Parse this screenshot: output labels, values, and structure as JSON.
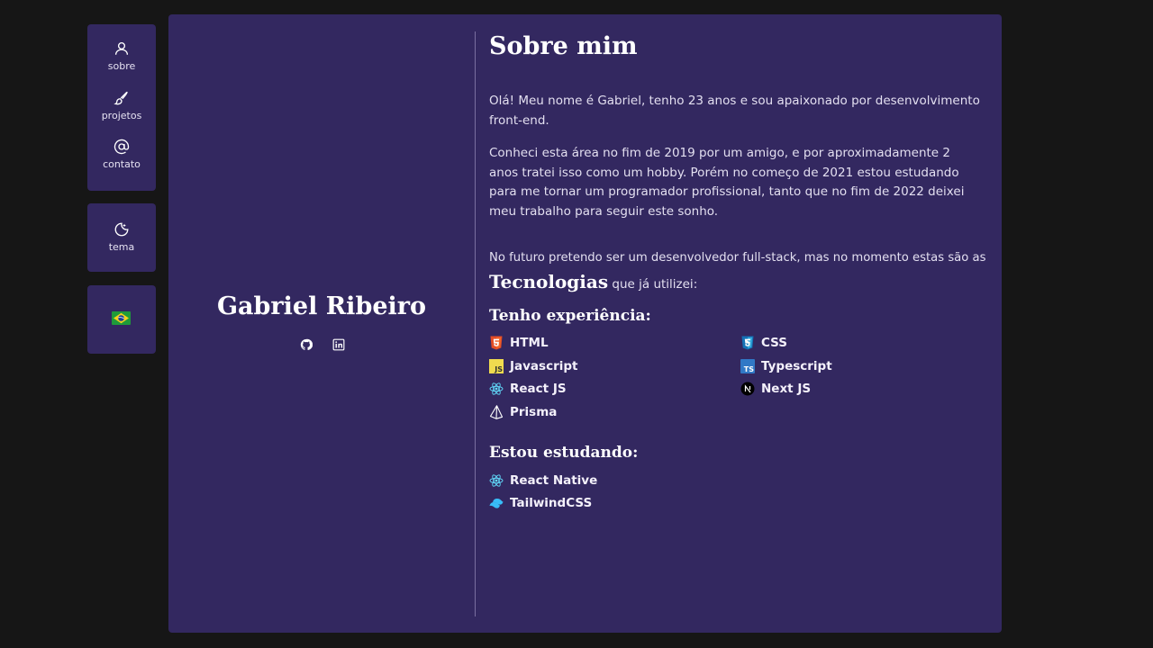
{
  "sidebar": {
    "nav": [
      {
        "label": "sobre",
        "icon": "user-icon"
      },
      {
        "label": "projetos",
        "icon": "brush-icon"
      },
      {
        "label": "contato",
        "icon": "at-sign-icon"
      }
    ],
    "theme": {
      "label": "tema",
      "icon": "moon-icon"
    },
    "language": {
      "icon": "brazil-flag-icon"
    }
  },
  "profile": {
    "name": "Gabriel Ribeiro",
    "socials": [
      {
        "icon": "github-icon"
      },
      {
        "icon": "linkedin-icon"
      }
    ]
  },
  "about": {
    "title": "Sobre mim",
    "p1": "Olá! Meu nome é Gabriel, tenho 23 anos e sou apaixonado por desenvolvimento front-end.",
    "p2": "Conheci esta área no fim de 2019 por um amigo, e por aproximadamente 2 anos tratei isso como um hobby. Porém no começo de 2021 estou estudando para me tornar um programador profissional, tanto que no fim de 2022 deixei meu trabalho para seguir este sonho.",
    "p3": "No futuro pretendo ser um desenvolvedor full-stack, mas no momento estas são as",
    "tech_word": "Tecnologias",
    "tech_suffix": "que já utilizei:",
    "experience_title": "Tenho experiência:",
    "experience": [
      {
        "name": "HTML",
        "icon": "html5-icon"
      },
      {
        "name": "CSS",
        "icon": "css3-icon"
      },
      {
        "name": "Javascript",
        "icon": "javascript-icon"
      },
      {
        "name": "Typescript",
        "icon": "typescript-icon"
      },
      {
        "name": "React JS",
        "icon": "react-icon"
      },
      {
        "name": "Next JS",
        "icon": "nextjs-icon"
      },
      {
        "name": "Prisma",
        "icon": "prisma-icon"
      }
    ],
    "studying_title": "Estou estudando:",
    "studying": [
      {
        "name": "React Native",
        "icon": "react-icon"
      },
      {
        "name": "TailwindCSS",
        "icon": "tailwind-icon"
      }
    ]
  },
  "colors": {
    "background": "#161616",
    "card": "#332860",
    "text": "#e3dff0"
  }
}
